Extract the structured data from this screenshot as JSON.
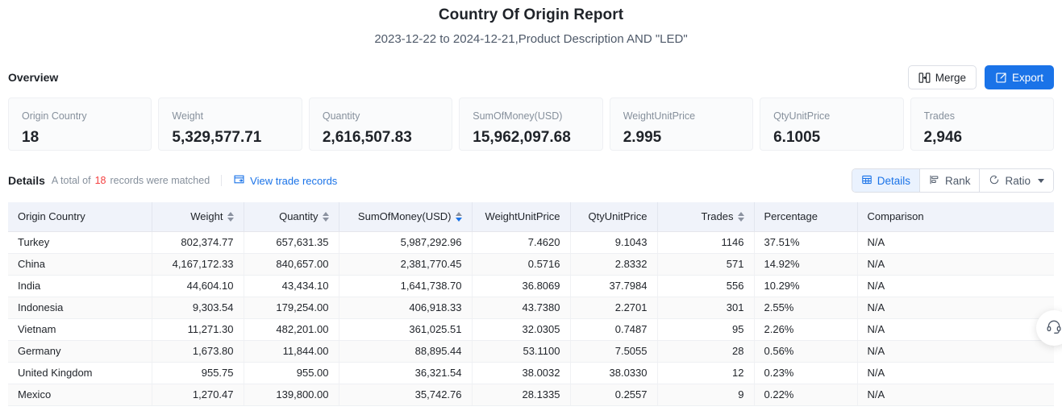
{
  "report": {
    "title": "Country Of Origin Report",
    "subtitle": "2023-12-22 to 2024-12-21,Product Description AND \"LED\""
  },
  "overview": {
    "label": "Overview",
    "merge_button": "Merge",
    "export_button": "Export",
    "cards": [
      {
        "label": "Origin Country",
        "value": "18"
      },
      {
        "label": "Weight",
        "value": "5,329,577.71"
      },
      {
        "label": "Quantity",
        "value": "2,616,507.83"
      },
      {
        "label": "SumOfMoney(USD)",
        "value": "15,962,097.68"
      },
      {
        "label": "WeightUnitPrice",
        "value": "2.995"
      },
      {
        "label": "QtyUnitPrice",
        "value": "6.1005"
      },
      {
        "label": "Trades",
        "value": "2,946"
      }
    ]
  },
  "details": {
    "title": "Details",
    "meta_prefix": "A total of",
    "meta_count": "18",
    "meta_suffix": "records were matched",
    "trade_link": "View trade records",
    "view_modes": [
      {
        "label": "Details",
        "icon": "table-icon",
        "active": true,
        "caret": false
      },
      {
        "label": "Rank",
        "icon": "bar-chart-icon",
        "active": false,
        "caret": false
      },
      {
        "label": "Ratio",
        "icon": "pie-chart-icon",
        "active": false,
        "caret": true
      }
    ]
  },
  "table": {
    "columns": [
      {
        "label": "Origin Country",
        "align": "left",
        "sortable": false,
        "sort": "none"
      },
      {
        "label": "Weight",
        "align": "right",
        "sortable": true,
        "sort": "none"
      },
      {
        "label": "Quantity",
        "align": "right",
        "sortable": true,
        "sort": "none"
      },
      {
        "label": "SumOfMoney(USD)",
        "align": "right",
        "sortable": true,
        "sort": "desc"
      },
      {
        "label": "WeightUnitPrice",
        "align": "right",
        "sortable": false,
        "sort": "none"
      },
      {
        "label": "QtyUnitPrice",
        "align": "right",
        "sortable": false,
        "sort": "none"
      },
      {
        "label": "Trades",
        "align": "right",
        "sortable": true,
        "sort": "none"
      },
      {
        "label": "Percentage",
        "align": "left",
        "sortable": false,
        "sort": "none"
      },
      {
        "label": "Comparison",
        "align": "left",
        "sortable": false,
        "sort": "none"
      }
    ],
    "rows": [
      [
        "Turkey",
        "802,374.77",
        "657,631.35",
        "5,987,292.96",
        "7.4620",
        "9.1043",
        "1146",
        "37.51%",
        "N/A"
      ],
      [
        "China",
        "4,167,172.33",
        "840,657.00",
        "2,381,770.45",
        "0.5716",
        "2.8332",
        "571",
        "14.92%",
        "N/A"
      ],
      [
        "India",
        "44,604.10",
        "43,434.10",
        "1,641,738.70",
        "36.8069",
        "37.7984",
        "556",
        "10.29%",
        "N/A"
      ],
      [
        "Indonesia",
        "9,303.54",
        "179,254.00",
        "406,918.33",
        "43.7380",
        "2.2701",
        "301",
        "2.55%",
        "N/A"
      ],
      [
        "Vietnam",
        "11,271.30",
        "482,201.00",
        "361,025.51",
        "32.0305",
        "0.7487",
        "95",
        "2.26%",
        "N/A"
      ],
      [
        "Germany",
        "1,673.80",
        "11,844.00",
        "88,895.44",
        "53.1100",
        "7.5055",
        "28",
        "0.56%",
        "N/A"
      ],
      [
        "United Kingdom",
        "955.75",
        "955.00",
        "36,321.54",
        "38.0032",
        "38.0330",
        "12",
        "0.23%",
        "N/A"
      ],
      [
        "Mexico",
        "1,270.47",
        "139,800.00",
        "35,742.76",
        "28.1335",
        "0.2557",
        "9",
        "0.22%",
        "N/A"
      ]
    ]
  },
  "support": {
    "icon": "headset-icon"
  },
  "colors": {
    "accent": "#1a73e8",
    "accent_soft": "#eaf2fe",
    "header_bg": "#f0f3fa",
    "danger": "#f53f3f",
    "muted": "#86909c"
  }
}
